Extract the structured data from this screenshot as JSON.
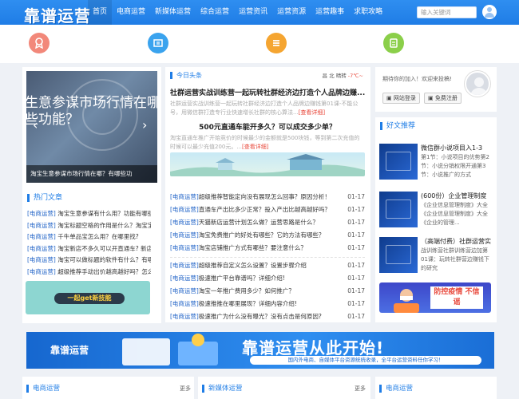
{
  "header": {
    "logo": "靠谱运营",
    "nav": [
      "首页",
      "电商运营",
      "新媒体运营",
      "综合运营",
      "运营资讯",
      "运营资源",
      "运营趣事",
      "求职攻略"
    ],
    "search_placeholder": "输入关键词"
  },
  "slider": {
    "big_text_line1": "生意参谋市场行情在哪",
    "big_text_line2": "些功能？",
    "caption": "淘宝生意参谋市场行情在哪？有哪些功",
    "prev": "‹",
    "next": "›"
  },
  "hot": {
    "title": "热门文章",
    "items": [
      {
        "tag": "[电商运营]",
        "text": "淘宝生意参谋有什么用？功能有哪些?"
      },
      {
        "tag": "[电商运营]",
        "text": "淘宝标题空格的作用是什么？淘宝宝贝"
      },
      {
        "tag": "[电商运营]",
        "text": "千牛单品宝怎么用？在哪里找?"
      },
      {
        "tag": "[电商运营]",
        "text": "淘宝新店不多久可以开直通车? 新店各必"
      },
      {
        "tag": "[电商运营]",
        "text": "淘宝可以做标题的软件有什么？有哪款"
      },
      {
        "tag": "[电商运营]",
        "text": "超级推荐手动出价越高越好吗？怎么出"
      }
    ],
    "banner_text": "一起get新技能"
  },
  "headline": {
    "title": "今日头条",
    "weather": {
      "city1": "昌",
      "city2": "北",
      "today": "晴转",
      "temp": "-7℃~"
    },
    "article1_title": "社群运营实战训练营一起玩转社群经济边打造个人品牌边赚...",
    "article1_desc": "社群运营实战训练营一起玩转社群经济边打造个人品牌边赚钱第01课-不能公号，用微信群打造专行业快速增长社群的核心算法...",
    "article1_more": "[查看详细]",
    "article2_title": "500元直通车能开多久？可以成交多少单？",
    "article2_desc": "淘宝直通车推广开始竞价的时候最少的金额就是500块钱，等到第二次充值的时候可以最少充值200元。...",
    "article2_more": "[查看详细]"
  },
  "news_group1": [
    {
      "tag": "[电商运营]",
      "text": "超级推荐智能定向没有展现怎么回事？原因分析！",
      "date": "01-17"
    },
    {
      "tag": "[电商运营]",
      "text": "直通车产出比多少正常？投入产出比越高越好吗？",
      "date": "01-17"
    },
    {
      "tag": "[电商运营]",
      "text": "天猫新店运营计划怎么做？运营思路是什么？",
      "date": "01-17"
    },
    {
      "tag": "[电商运营]",
      "text": "淘宝免费推广的好处有哪些？它的方法有哪些？",
      "date": "01-17"
    },
    {
      "tag": "[电商运营]",
      "text": "淘宝店铺推广方式有哪些？要注意什么？",
      "date": "01-17"
    }
  ],
  "news_group2": [
    {
      "tag": "[电商运营]",
      "text": "超级推荐自定义怎么设置？设置步骤介绍",
      "date": "01-17"
    },
    {
      "tag": "[电商运营]",
      "text": "极速推广平台靠谱吗？详细介绍!",
      "date": "01-17"
    },
    {
      "tag": "[电商运营]",
      "text": "淘宝一年推广费用多少？如何推广？",
      "date": "01-17"
    },
    {
      "tag": "[电商运营]",
      "text": "极速推推在哪里展现？详细内容介绍!",
      "date": "01-17"
    },
    {
      "tag": "[电商运营]",
      "text": "极速推广为什么没有曝光？没有点击是何原因?",
      "date": "01-17"
    }
  ],
  "user_panel": {
    "welcome": "期待你的加入！欢迎来投稿!",
    "login": "网站登录",
    "register": "免费注册"
  },
  "recommend": {
    "title": "好文推荐",
    "items": [
      {
        "title": "微信群小说项目入1-3",
        "desc": "第1节：小说项目的优势第2节：小说分销权限开通第3节：小说推广的方式"
      },
      {
        "title": "(600份）企业管理制度",
        "desc": "《企业信息管理制度》大全《企业信息管理制度》大全《企业的管理..."
      },
      {
        "title": "（高端付费）社群运营实",
        "desc": "战训练营社群训练营边加第01课：玩转社群营边赚钱下的研究"
      }
    ],
    "banner_text": "防控疫情 不信谣"
  },
  "big_banner": {
    "left": "靠谱运营",
    "title": "靠谱运营从此开始!",
    "subtitle": "国内外电商、自媒体平台资源统统收录，全平台运营资料任你学习！"
  },
  "bottom": {
    "col1": "电商运营",
    "col2": "新媒体运营",
    "col3": "电商运营",
    "more": "更多"
  }
}
